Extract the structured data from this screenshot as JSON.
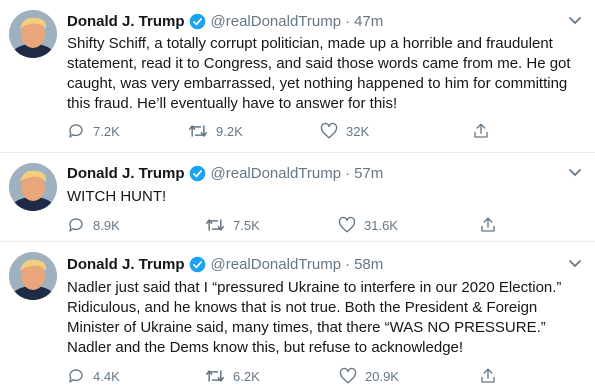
{
  "tweets": [
    {
      "name": "Donald J. Trump",
      "handle": "@realDonaldTrump",
      "separator": "·",
      "time": "47m",
      "text": "Shifty Schiff, a totally corrupt politician, made up a horrible and fraudulent statement, read it to Congress, and said those words came from me. He got caught, was very embarrassed, yet nothing happened to him for committing this fraud. He’ll eventually have to answer for this!",
      "replies": "7.2K",
      "retweets": "9.2K",
      "likes": "32K"
    },
    {
      "name": "Donald J. Trump",
      "handle": "@realDonaldTrump",
      "separator": "·",
      "time": "57m",
      "text": "WITCH HUNT!",
      "replies": "8.9K",
      "retweets": "7.5K",
      "likes": "31.6K"
    },
    {
      "name": "Donald J. Trump",
      "handle": "@realDonaldTrump",
      "separator": "·",
      "time": "58m",
      "text": "Nadler just said that I “pressured Ukraine to interfere in our 2020 Election.” Ridiculous, and he knows that is not true. Both the President & Foreign Minister of Ukraine said, many times, that there “WAS NO PRESSURE.” Nadler and the Dems know this, but refuse to acknowledge!",
      "replies": "4.4K",
      "retweets": "6.2K",
      "likes": "20.9K"
    }
  ],
  "icons": {
    "verified": "verified-badge-icon",
    "caret": "chevron-down-icon",
    "reply": "reply-icon",
    "retweet": "retweet-icon",
    "like": "heart-icon",
    "share": "share-icon"
  },
  "colors": {
    "verified": "#1da1f2",
    "muted": "#657786",
    "text": "#14171a",
    "divider": "#e6ecf0"
  }
}
